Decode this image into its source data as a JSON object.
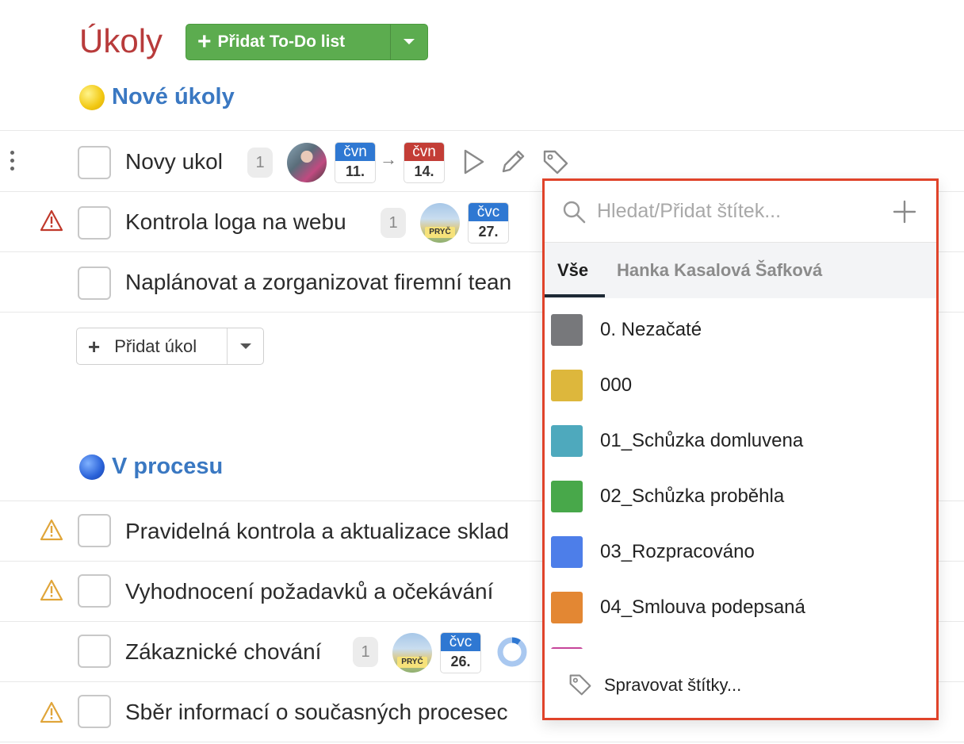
{
  "page": {
    "title": "Úkoly"
  },
  "toolbar": {
    "add_list_label": "Přidat To-Do list"
  },
  "sections": [
    {
      "title": "Nové úkoly",
      "tasks": [
        {
          "text": "Novy ukol",
          "count": "1",
          "date_from": {
            "month": "čvn",
            "day": "11."
          },
          "date_to": {
            "month": "čvn",
            "day": "14."
          }
        },
        {
          "text": "Kontrola loga na webu",
          "count": "1",
          "away_badge": "PRYČ",
          "date": {
            "month": "čvc",
            "day": "27."
          }
        },
        {
          "text": "Naplánovat a zorganizovat firemní tean"
        }
      ],
      "add_task_label": "Přidat úkol"
    },
    {
      "title": "V procesu",
      "tasks": [
        {
          "text": "Pravidelná kontrola a aktualizace sklad"
        },
        {
          "text": "Vyhodnocení požadavků a očekávání"
        },
        {
          "text": "Zákaznické chování",
          "count": "1",
          "away_badge": "PRYČ",
          "date": {
            "month": "čvc",
            "day": "26."
          },
          "progress": 0.1
        },
        {
          "text": "Sběr informací o současných procesec"
        }
      ]
    }
  ],
  "tag_popup": {
    "search_placeholder": "Hledat/Přidat štítek...",
    "tabs": [
      "Vše",
      "Hanka Kasalová Šafková"
    ],
    "tags": [
      {
        "label": "0. Nezačaté",
        "color": "#77787b"
      },
      {
        "label": "000",
        "color": "#ddb73c"
      },
      {
        "label": "01_Schůzka domluvena",
        "color": "#4ea9bd"
      },
      {
        "label": "02_Schůzka proběhla",
        "color": "#48a84a"
      },
      {
        "label": "03_Rozpracováno",
        "color": "#4d7ee9"
      },
      {
        "label": "04_Smlouva podepsaná",
        "color": "#e38733"
      },
      {
        "label": "",
        "color": "#c6459a"
      }
    ],
    "manage_label": "Spravovat štítky..."
  },
  "colors": {
    "accent_red": "#e0432a",
    "green_button": "#5cac4f",
    "section_blue": "#3a78c2",
    "title_red": "#b83b3b"
  },
  "icons": [
    "search-icon",
    "plus-icon",
    "tag-icon",
    "play-icon",
    "pencil-icon",
    "warning-icon",
    "chevron-down-icon",
    "kebab-icon"
  ]
}
